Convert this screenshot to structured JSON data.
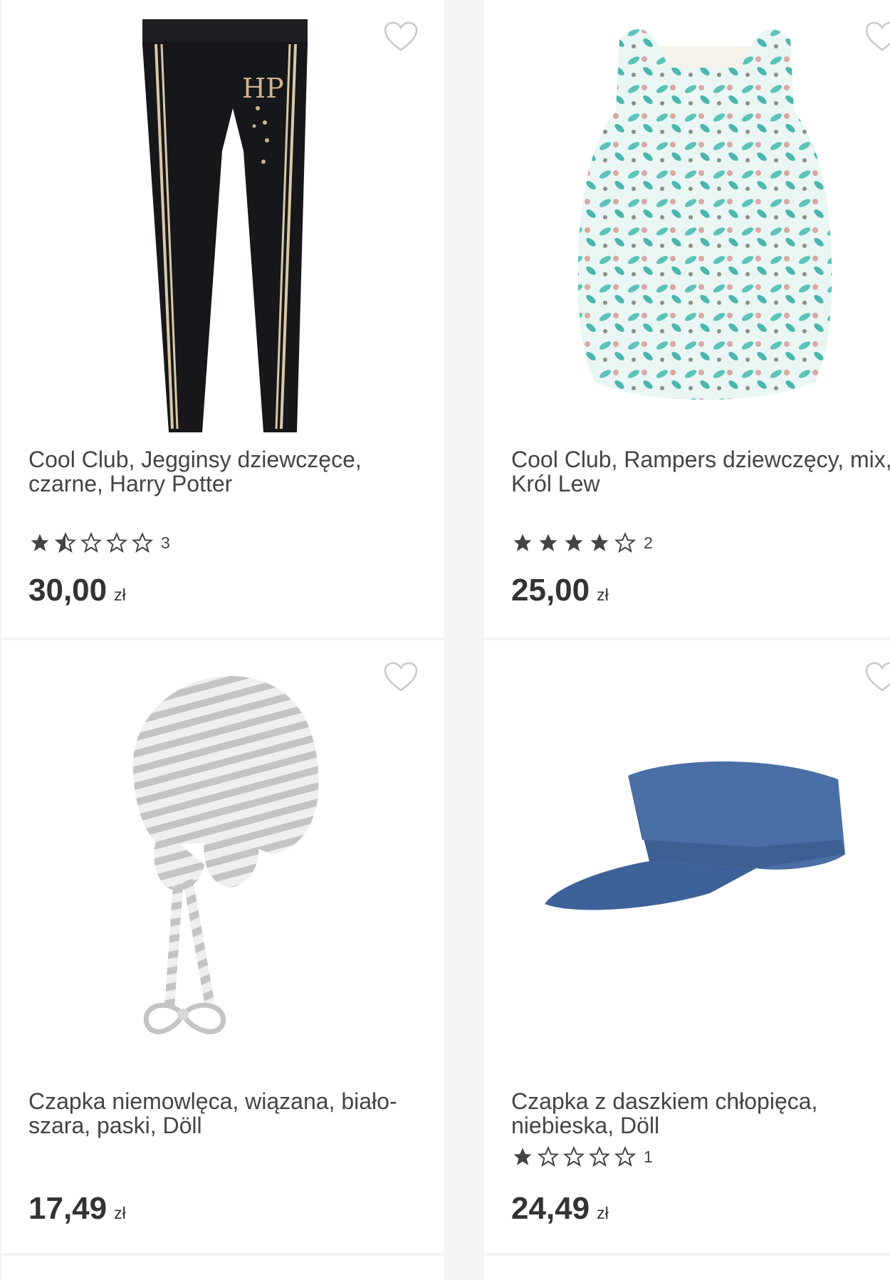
{
  "products": [
    {
      "title": "Cool Club, Jegginsy dziewczęce, czarne, Harry Potter",
      "rating": 1.5,
      "rating_count": "3",
      "price": "30,00",
      "currency": "zł",
      "image": "black-leggings-harry-potter"
    },
    {
      "title": "Cool Club, Rampers dziewczęcy, mix, Król Lew",
      "rating": 4,
      "rating_count": "2",
      "price": "25,00",
      "currency": "zł",
      "image": "floral-romper-teal"
    },
    {
      "title": "Czapka niemowlęca, wiązana, biało-szara, paski, Döll",
      "rating": null,
      "rating_count": "",
      "price": "17,49",
      "currency": "zł",
      "image": "striped-baby-hat"
    },
    {
      "title": "Czapka z daszkiem chłopięca, niebieska, Döll",
      "rating": 1,
      "rating_count": "1",
      "price": "24,49",
      "currency": "zł",
      "image": "blue-cap"
    }
  ],
  "colors": {
    "page_background": "#f3f3f3",
    "card_background": "#ffffff",
    "text": "#444444",
    "star": "#444444"
  }
}
